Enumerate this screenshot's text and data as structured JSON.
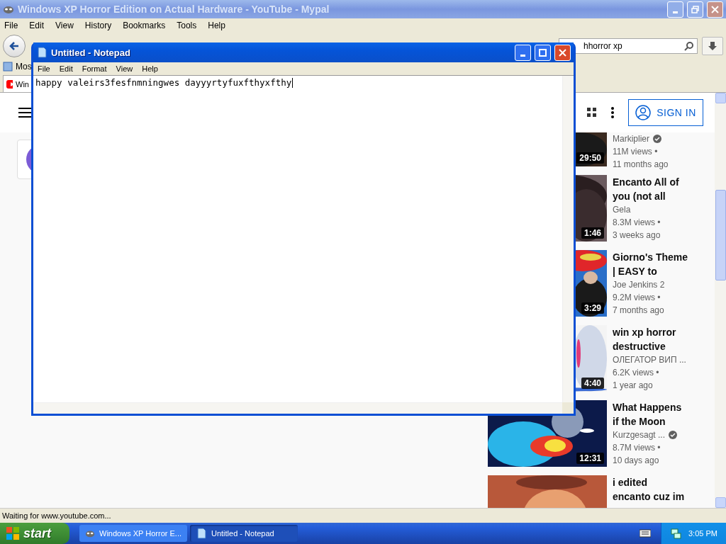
{
  "browser": {
    "title": "Windows XP Horror Edition on Actual Hardware - YouTube - Mypal",
    "active": false,
    "menu": [
      "File",
      "Edit",
      "View",
      "History",
      "Bookmarks",
      "Tools",
      "Help"
    ],
    "search": {
      "value": "hhorror xp"
    },
    "bookmarks": [
      {
        "label": "Mos"
      }
    ],
    "tabs": [
      {
        "label": "Win",
        "selected": true
      }
    ],
    "youtube": {
      "sign_in": "SIGN IN",
      "videos": [
        {
          "channel": "Markiplier",
          "verified": true,
          "views": "11M views •",
          "age": "11 months ago",
          "duration": "29:50"
        },
        {
          "title_lines": [
            "Encanto All of",
            "you (not all"
          ],
          "channel": "Gela",
          "verified": false,
          "views": "8.3M views •",
          "age": "3 weeks ago",
          "duration": "1:46"
        },
        {
          "title_lines": [
            "Giorno's Theme",
            "| EASY to"
          ],
          "channel": "Joe Jenkins 2",
          "verified": false,
          "views": "9.2M views •",
          "age": "7 months ago",
          "duration": "3:29"
        },
        {
          "title_lines": [
            "win xp horror",
            "destructive"
          ],
          "channel": "ОЛЕГАТОР ВИП ...",
          "verified": false,
          "views": "6.2K views •",
          "age": "1 year ago",
          "duration": "4:40"
        },
        {
          "title_lines": [
            "What Happens",
            "if the Moon"
          ],
          "channel": "Kurzgesagt ...",
          "verified": true,
          "views": "8.7M views •",
          "age": "10 days ago",
          "duration": "12:31"
        },
        {
          "title_lines": [
            "i edited",
            "encanto cuz im"
          ]
        }
      ]
    },
    "status": "Waiting for www.youtube.com..."
  },
  "notepad": {
    "title": "Untitled - Notepad",
    "active": true,
    "menu": [
      "File",
      "Edit",
      "Format",
      "View",
      "Help"
    ],
    "text": "happy valeirs3fesfnmningwes dayyyrtyfuxfthyxfthy"
  },
  "taskbar": {
    "start": "start",
    "buttons": [
      {
        "label": "Windows XP Horror E...",
        "selected": false
      },
      {
        "label": "Untitled - Notepad",
        "selected": true
      }
    ],
    "clock": "3:05 PM"
  }
}
